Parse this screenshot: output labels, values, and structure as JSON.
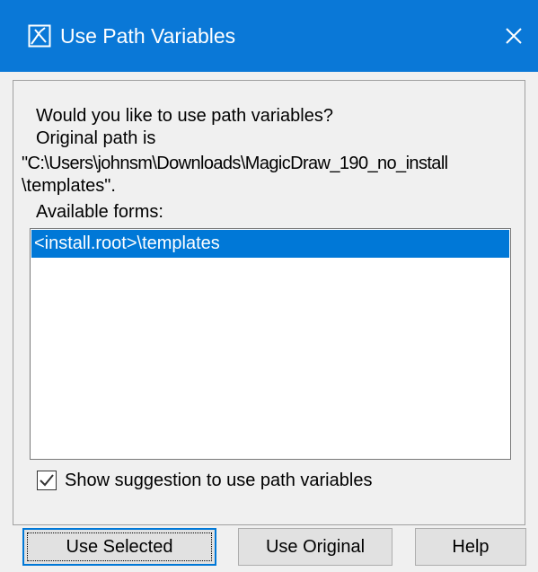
{
  "window": {
    "title": "Use Path Variables",
    "title_icon": "magicdraw-app-icon",
    "close_icon": "close-icon",
    "accent_color": "#0078d7"
  },
  "message": {
    "line1": "Would you like to use path variables?",
    "line2": "Original path is",
    "line3": "\"C:\\Users\\johnsm\\Downloads\\MagicDraw_190_no_install",
    "line4": "\\templates\".",
    "line5": "Available forms:"
  },
  "forms_list": {
    "items": [
      {
        "label": "<install.root>\\templates",
        "selected": true
      }
    ]
  },
  "suggestion_checkbox": {
    "label": "Show suggestion to use path variables",
    "checked": true
  },
  "buttons": {
    "use_selected": "Use Selected",
    "use_original": "Use Original",
    "help": "Help"
  }
}
